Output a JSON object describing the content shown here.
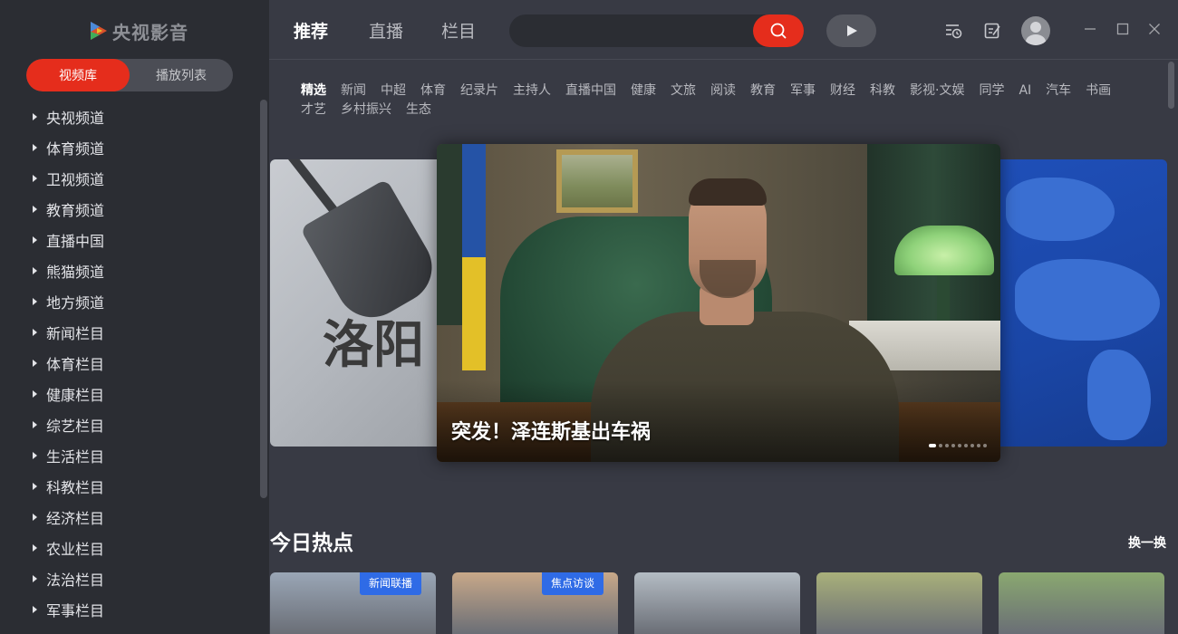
{
  "app": {
    "logo_text": "央视影音"
  },
  "sidebar": {
    "segments": [
      {
        "label": "视频库",
        "active": true
      },
      {
        "label": "播放列表",
        "active": false
      }
    ],
    "items": [
      "央视频道",
      "体育频道",
      "卫视频道",
      "教育频道",
      "直播中国",
      "熊猫频道",
      "地方频道",
      "新闻栏目",
      "体育栏目",
      "健康栏目",
      "综艺栏目",
      "生活栏目",
      "科教栏目",
      "经济栏目",
      "农业栏目",
      "法治栏目",
      "军事栏目"
    ]
  },
  "header": {
    "tabs": [
      {
        "label": "推荐",
        "active": true
      },
      {
        "label": "直播",
        "active": false
      },
      {
        "label": "栏目",
        "active": false
      }
    ],
    "search": {
      "placeholder": ""
    },
    "icons": [
      "search-icon",
      "play-icon",
      "history-icon",
      "edit-icon",
      "user-avatar",
      "minimize-icon",
      "maximize-icon",
      "close-icon"
    ]
  },
  "categories": {
    "items": [
      "精选",
      "新闻",
      "中超",
      "体育",
      "纪录片",
      "主持人",
      "直播中国",
      "健康",
      "文旅",
      "阅读",
      "教育",
      "军事",
      "财经",
      "科教",
      "影视·文娱",
      "同学",
      "AI",
      "汽车",
      "书画",
      "才艺",
      "乡村振兴",
      "生态"
    ],
    "active_index": 0
  },
  "carousel": {
    "left_callig": "洛阳",
    "main_caption": "突发！泽连斯基出车祸",
    "dot_count": 9,
    "active_dot": 0
  },
  "hot": {
    "title": "今日热点",
    "refresh_label": "换一换",
    "cards": [
      {
        "badge": "新闻联播",
        "tone": "#9aa6b6"
      },
      {
        "badge": "焦点访谈",
        "tone": "#c8a889"
      },
      {
        "badge": "",
        "tone": "#b4bcc4"
      },
      {
        "badge": "",
        "tone": "#a9b07a"
      },
      {
        "badge": "",
        "tone": "#8aa870"
      }
    ]
  },
  "colors": {
    "accent": "#e52d1c",
    "badge": "#2f6be6",
    "sidebar_bg": "#2b2d33",
    "main_bg": "#383a44"
  }
}
